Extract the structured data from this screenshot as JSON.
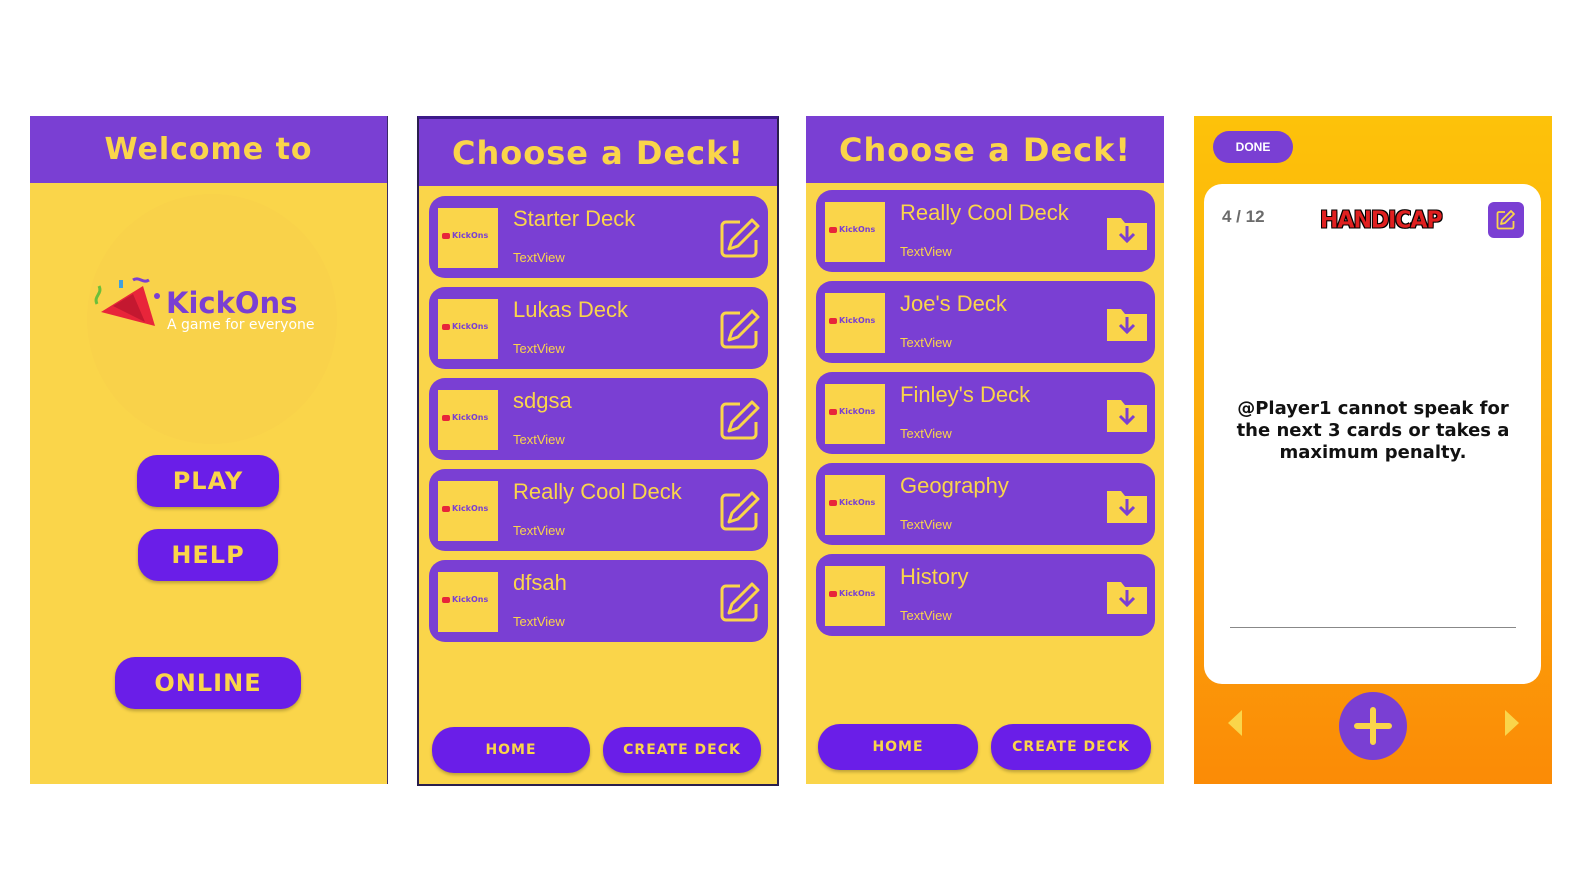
{
  "colors": {
    "purple": "#7a3fd3",
    "button_purple": "#6a1ee8",
    "yellow": "#fad54a",
    "orange": "#fb8b06"
  },
  "welcome_screen": {
    "title": "Welcome to",
    "logo_title": "KickOns",
    "logo_subtitle": "A game for everyone",
    "play_label": "PLAY",
    "help_label": "HELP",
    "online_label": "ONLINE"
  },
  "my_decks_screen": {
    "title": "Choose a Deck!",
    "action_icon": "edit-icon",
    "thumb_text": "KickOns",
    "decks": [
      {
        "name": "Starter Deck",
        "subtitle": "TextView"
      },
      {
        "name": "Lukas Deck",
        "subtitle": "TextView"
      },
      {
        "name": "sdgsa",
        "subtitle": "TextView"
      },
      {
        "name": "Really Cool Deck",
        "subtitle": "TextView"
      },
      {
        "name": "dfsah",
        "subtitle": "TextView"
      }
    ],
    "home_label": "HOME",
    "create_label": "CREATE DECK"
  },
  "online_decks_screen": {
    "title": "Choose a Deck!",
    "action_icon": "download-folder-icon",
    "thumb_text": "KickOns",
    "decks": [
      {
        "name": "Really Cool Deck",
        "subtitle": "TextView"
      },
      {
        "name": "Joe's Deck",
        "subtitle": "TextView"
      },
      {
        "name": "Finley's Deck",
        "subtitle": "TextView"
      },
      {
        "name": "Geography",
        "subtitle": "TextView"
      },
      {
        "name": "History",
        "subtitle": "TextView"
      }
    ],
    "home_label": "HOME",
    "create_label": "CREATE DECK"
  },
  "card_screen": {
    "done_label": "DONE",
    "counter": "4 / 12",
    "category": "HANDICAP",
    "card_text": "@Player1 cannot speak for the next 3 cards or takes a maximum penalty."
  }
}
